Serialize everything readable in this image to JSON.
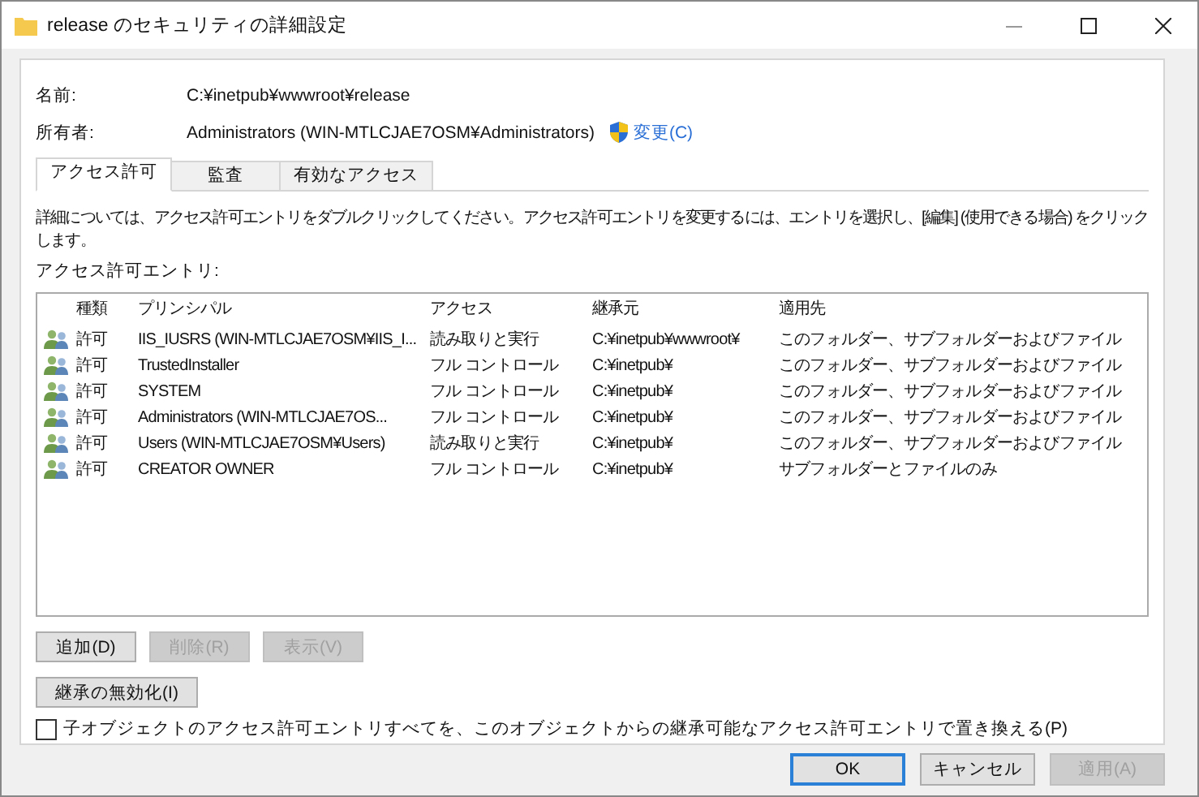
{
  "window": {
    "title": "release のセキュリティの詳細設定"
  },
  "name": {
    "label": "名前:",
    "value": "C:¥inetpub¥wwwroot¥release"
  },
  "owner": {
    "label": "所有者:",
    "value": "Administrators (WIN-MTLCJAE7OSM¥Administrators)",
    "change_link": "変更(C)"
  },
  "tabs": [
    {
      "label": "アクセス許可",
      "selected": true
    },
    {
      "label": "監査",
      "selected": false
    },
    {
      "label": "有効なアクセス",
      "selected": false
    }
  ],
  "description": "詳細については、アクセス許可エントリをダブルクリックしてください。アクセス許可エントリを変更するには、エントリを選択し、[編集] (使用できる場合) をクリックします。",
  "entries_label": "アクセス許可エントリ:",
  "table": {
    "columns": [
      "種類",
      "プリンシパル",
      "アクセス",
      "継承元",
      "適用先"
    ],
    "rows": [
      {
        "type": "許可",
        "principal": "IIS_IUSRS (WIN-MTLCJAE7OSM¥IIS_I...",
        "access": "読み取りと実行",
        "inherited_from": "C:¥inetpub¥wwwroot¥",
        "applies_to": "このフォルダー、サブフォルダーおよびファイル"
      },
      {
        "type": "許可",
        "principal": "TrustedInstaller",
        "access": "フル コントロール",
        "inherited_from": "C:¥inetpub¥",
        "applies_to": "このフォルダー、サブフォルダーおよびファイル"
      },
      {
        "type": "許可",
        "principal": "SYSTEM",
        "access": "フル コントロール",
        "inherited_from": "C:¥inetpub¥",
        "applies_to": "このフォルダー、サブフォルダーおよびファイル"
      },
      {
        "type": "許可",
        "principal": "Administrators (WIN-MTLCJAE7OS...",
        "access": "フル コントロール",
        "inherited_from": "C:¥inetpub¥",
        "applies_to": "このフォルダー、サブフォルダーおよびファイル"
      },
      {
        "type": "許可",
        "principal": "Users (WIN-MTLCJAE7OSM¥Users)",
        "access": "読み取りと実行",
        "inherited_from": "C:¥inetpub¥",
        "applies_to": "このフォルダー、サブフォルダーおよびファイル"
      },
      {
        "type": "許可",
        "principal": "CREATOR OWNER",
        "access": "フル コントロール",
        "inherited_from": "C:¥inetpub¥",
        "applies_to": "サブフォルダーとファイルのみ"
      }
    ]
  },
  "entry_buttons": [
    {
      "label": "追加(D)",
      "disabled": false
    },
    {
      "label": "削除(R)",
      "disabled": true
    },
    {
      "label": "表示(V)",
      "disabled": true
    }
  ],
  "disable_inheritance_button": {
    "label": "継承の無効化(I)"
  },
  "replace_checkbox": {
    "label": "子オブジェクトのアクセス許可エントリすべてを、このオブジェクトからの継承可能なアクセス許可エントリで置き換える(P)",
    "checked": false
  },
  "dialog_buttons": [
    {
      "label": "OK",
      "disabled": false,
      "default": true
    },
    {
      "label": "キャンセル",
      "disabled": false,
      "default": false
    },
    {
      "label": "適用(A)",
      "disabled": true,
      "default": false
    }
  ]
}
